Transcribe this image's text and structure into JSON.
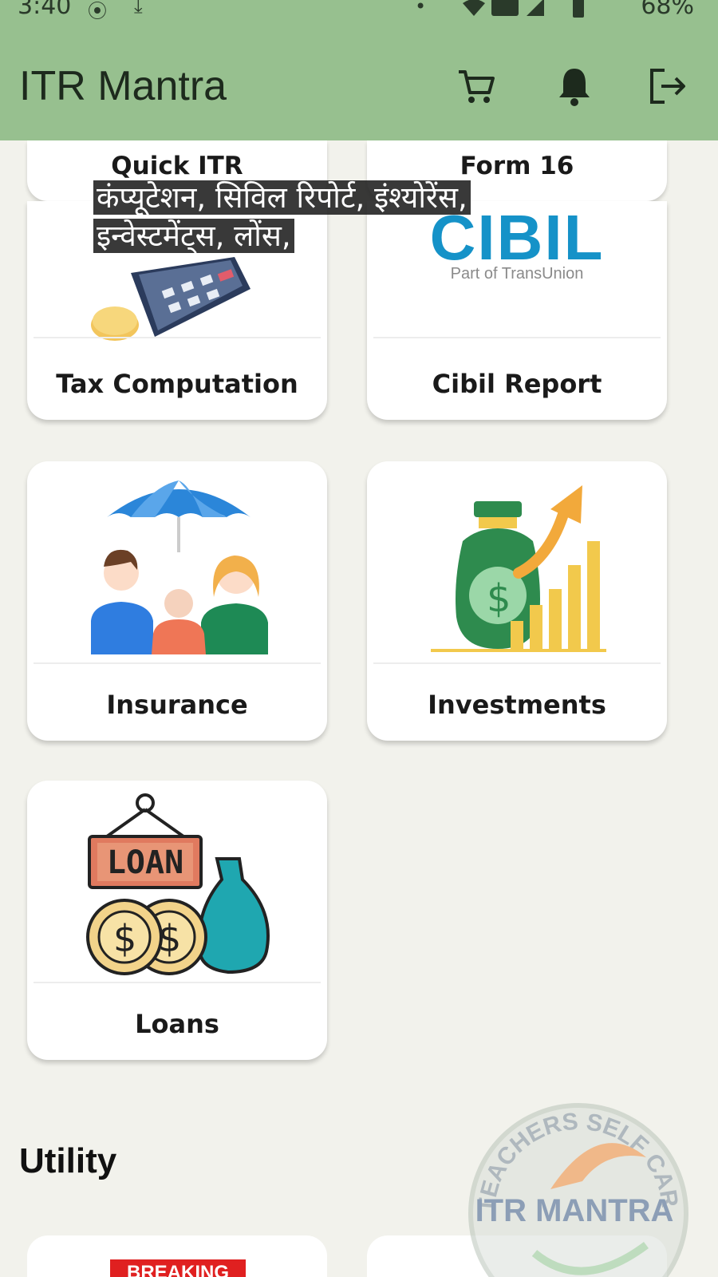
{
  "status_bar": {
    "time": "3:40",
    "battery": "68%"
  },
  "app_bar": {
    "title": "ITR Mantra",
    "background": "#97c08f"
  },
  "caption": {
    "line1": "कंप्यूटेशन, सिविल रिपोर्ट, इंश्योरेंस,",
    "line2": "इन्वेस्टमेंट्स, लोंस,"
  },
  "top_cards": [
    "Quick ITR",
    "Form 16"
  ],
  "cards": [
    {
      "label": "Tax Computation"
    },
    {
      "label": "Cibil Report",
      "logo_text": "CIBIL",
      "logo_sub": "Part of TransUnion"
    },
    {
      "label": "Insurance"
    },
    {
      "label": "Investments"
    },
    {
      "label": "Loans",
      "sign_text": "LOAN"
    }
  ],
  "section": {
    "title": "Utility"
  },
  "utility_cards": [
    {
      "badge": "BREAKING"
    }
  ],
  "watermark": {
    "text": "ITR MANTRA",
    "arc_text": "TEACHERS SELF CARE"
  },
  "colors": {
    "cibil_blue": "#1592c8",
    "card_bg": "#ffffff",
    "page_bg": "#f2f2ec"
  },
  "icons": [
    "cart-icon",
    "bell-icon",
    "logout-icon"
  ]
}
